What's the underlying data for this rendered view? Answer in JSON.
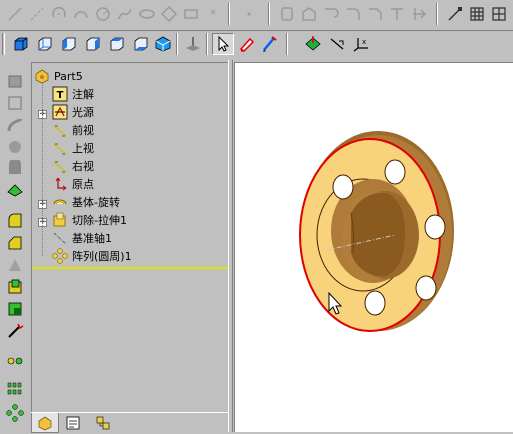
{
  "feature_tree": {
    "root": "Part5",
    "items": [
      {
        "label": "注解",
        "expandable": false
      },
      {
        "label": "光源",
        "expandable": true
      },
      {
        "label": "前视",
        "expandable": false
      },
      {
        "label": "上视",
        "expandable": false
      },
      {
        "label": "右视",
        "expandable": false
      },
      {
        "label": "原点",
        "expandable": false
      },
      {
        "label": "基体-旋转",
        "expandable": true
      },
      {
        "label": "切除-拉伸1",
        "expandable": true
      },
      {
        "label": "基准轴1",
        "expandable": false
      },
      {
        "label": "阵列(圆周)1",
        "expandable": false
      }
    ]
  },
  "colors": {
    "part_face": "#f9d37c",
    "part_bore": "#9c6a2a",
    "selection_edge": "#e00000",
    "tree_highlight": "#e8e000",
    "sketch_blue": "#0060ff"
  },
  "icons": {
    "top_toolbar": [
      "line-icon",
      "centerline-icon",
      "arc-icon",
      "tangent-arc-icon",
      "circle-icon",
      "spline-icon",
      "ellipse-icon",
      "polygon-icon",
      "rectangle-icon",
      "point-icon",
      "convert-entities-icon",
      "offset-icon",
      "mirror-icon",
      "fillet-icon",
      "trim-icon",
      "extend-icon",
      "grid-icon"
    ],
    "view_toolbar": [
      "front-view-icon",
      "back-view-icon",
      "left-view-icon",
      "right-view-icon",
      "top-view-icon",
      "isometric-view-icon",
      "normal-to-icon",
      "select-icon",
      "rebuild-icon",
      "sketch-icon",
      "sketch-plane-icon",
      "smart-dimension-icon",
      "coordinate-icon"
    ]
  }
}
